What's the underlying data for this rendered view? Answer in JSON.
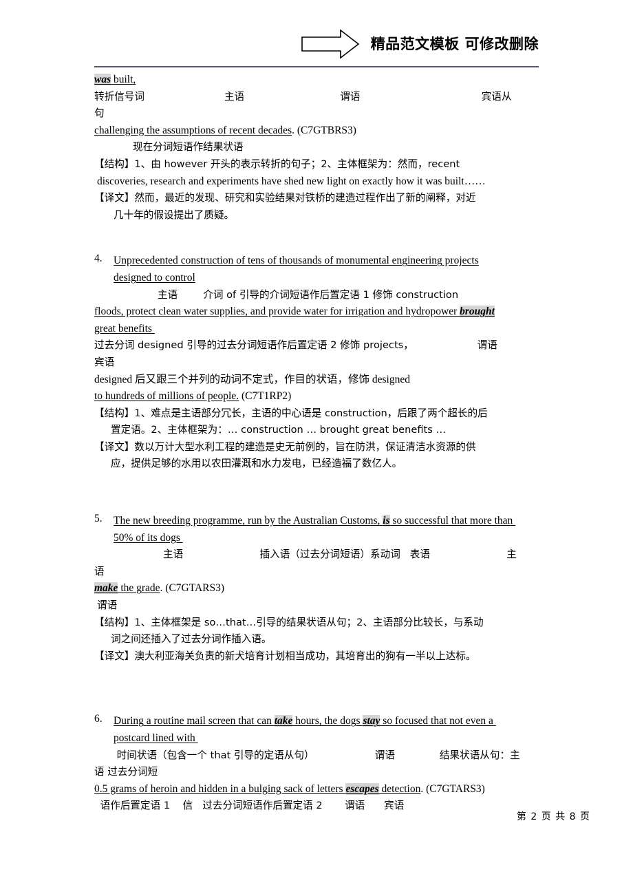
{
  "header": {
    "title": "精品范文模板  可修改删除",
    "arrow_icon": "right-arrow-icon"
  },
  "footer": {
    "page_label": "第 2 页  共 8 页"
  },
  "blocks": {
    "item3_tail": {
      "sentence_part": "was built,",
      "sentence_part_hl": "was",
      "sentence_part_rest": " built,",
      "roles_line1": "转折信号词                         主语                              谓语                                      宾语从",
      "roles_line2": "句",
      "sentence_cont": "challenging the assumptions of recent decades",
      "sentence_cont_ref": ". (C7GTBRS3)",
      "roles_line3": "现在分词短语作结果状语",
      "structure": "【结构】1、由 however 开头的表示转折的句子；2、主体框架为：然而，recent",
      "structure_cont": "discoveries, research and experiments have shed new light on exactly how it was built……",
      "translation": "【译文】然而，最近的发现、研究和实验结果对铁桥的建造过程作出了新的阐释，对近",
      "translation_cont": "几十年的假设提出了质疑。"
    },
    "item4": {
      "number": "4.",
      "line1_a": "Unprecedented ",
      "line1_b": "construction",
      "line1_c": " of tens of thousands of monumental engineering projects",
      "line2": "designed to control",
      "roles_line1": "主语        介词 of 引导的介词短语作后置定语 1 修饰 construction",
      "line3": "floods, protect clean water supplies, and provide water for irrigation and hydropower ",
      "line3_hl": "brought",
      "line4": "great benefits ",
      "roles_line2": "过去分词 designed 引导的过去分词短语作后置定语 2 修饰 projects，                    谓语",
      "roles_line3": "宾语",
      "line5": "designed 后又跟三个并列的动词不定式，作目的状语，修饰 designed",
      "line6": "to hundreds of millions of people.",
      "line6_ref": " (C7T1RP2)",
      "structure": "【结构】1、难点是主语部分冗长，主语的中心语是 construction，后跟了两个超长的后",
      "structure_cont": "置定语。2、主体框架为：… construction … brought great benefits …",
      "translation": "【译文】数以万计大型水利工程的建造是史无前例的，旨在防洪，保证清洁水资源的供",
      "translation_cont": "应，提供足够的水用以农田灌溉和水力发电，已经造福了数亿人。"
    },
    "item5": {
      "number": "5.",
      "line1_a": "The new breeding programme, run by the Australian Customs, ",
      "line1_hl": "is",
      "line1_b": " so successful",
      "line1_c": " that more than ",
      "line2": "50% of its dogs ",
      "roles_line1": "主语                        插入语（过去分词短语）系动词   表语                        主",
      "roles_line2": "语",
      "line3_hl": "make",
      "line3_b": " the grade",
      "line3_ref": ". (C7GTARS3)",
      "roles_line3": "谓语",
      "structure": "【结构】1、主体框架是 so…that…引导的结果状语从句；2、主语部分比较长，与系动",
      "structure_cont": "词之间还插入了过去分词作插入语。",
      "translation": "【译文】澳大利亚海关负责的新犬培育计划相当成功，其培育出的狗有一半以上达标。"
    },
    "item6": {
      "number": "6.",
      "line1_a": "During a routine mail screen that can ",
      "line1_hl1": "take",
      "line1_b": " hours",
      "line1_c": ", the dogs ",
      "line1_hl2": "stay",
      "line1_d": " so focused",
      "line1_e": " that not even a ",
      "line2": "postcard lined with ",
      "roles_line1": " 时间状语（包含一个 that 引导的定语从句）                   谓语              结果状语从句：主",
      "roles_line2": "语 过去分词短",
      "line3_a": "0.5 grams of heroin and hidden in a bulging sack of letters ",
      "line3_hl": "escapes",
      "line3_b": " detection",
      "line3_ref": ". (C7GTARS3)",
      "roles_line3": " 语作后置定语 1    信   过去分词短语作后置定语 2       谓语      宾语"
    }
  }
}
